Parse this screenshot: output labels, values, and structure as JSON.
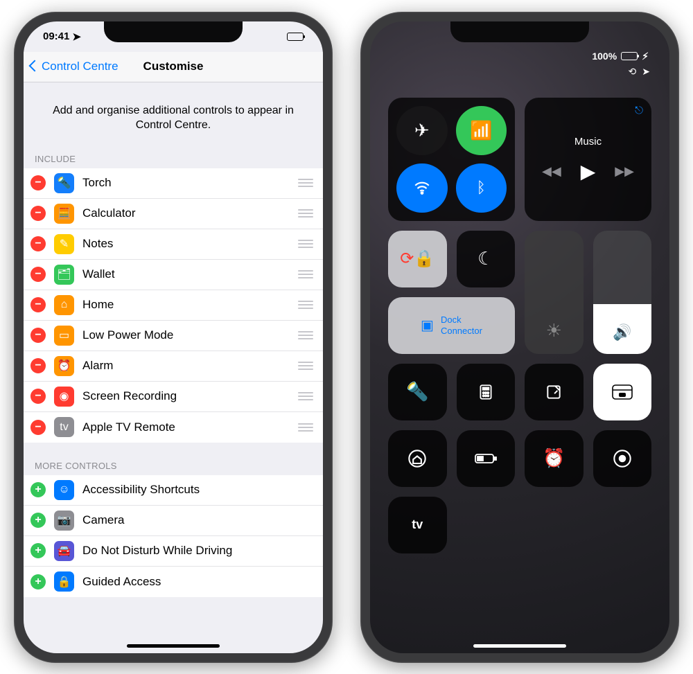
{
  "left": {
    "status_time": "09:41",
    "nav_back": "Control Centre",
    "nav_title": "Customise",
    "description": "Add and organise additional controls to appear in Control Centre.",
    "section_include": "Include",
    "section_more": "More Controls",
    "include": [
      {
        "label": "Torch",
        "color": "#147efb",
        "glyph": "🔦"
      },
      {
        "label": "Calculator",
        "color": "#ff9500",
        "glyph": "🧮"
      },
      {
        "label": "Notes",
        "color": "#ffcc00",
        "glyph": "✎"
      },
      {
        "label": "Wallet",
        "color": "#34c759",
        "glyph": "🗂"
      },
      {
        "label": "Home",
        "color": "#ff9500",
        "glyph": "⌂"
      },
      {
        "label": "Low Power Mode",
        "color": "#ff9500",
        "glyph": "▭"
      },
      {
        "label": "Alarm",
        "color": "#ff9500",
        "glyph": "⏰"
      },
      {
        "label": "Screen Recording",
        "color": "#ff3b30",
        "glyph": "◉"
      },
      {
        "label": "Apple TV Remote",
        "color": "#8e8e93",
        "glyph": "tv"
      }
    ],
    "more": [
      {
        "label": "Accessibility Shortcuts",
        "color": "#007aff",
        "glyph": "☺︎"
      },
      {
        "label": "Camera",
        "color": "#8e8e93",
        "glyph": "📷"
      },
      {
        "label": "Do Not Disturb While Driving",
        "color": "#5856d6",
        "glyph": "🚘"
      },
      {
        "label": "Guided Access",
        "color": "#007aff",
        "glyph": "🔒"
      }
    ]
  },
  "right": {
    "battery_pct": "100%",
    "music_label": "Music",
    "airplay_line1": "Dock",
    "airplay_line2": "Connector",
    "toggles": {
      "airplane": false,
      "cellular": true,
      "wifi": true,
      "bluetooth": true,
      "orientation_lock": true,
      "dnd": false
    },
    "sliders": {
      "brightness_pct": 0,
      "volume_pct": 40
    },
    "tiles": [
      "torch",
      "calculator",
      "notes",
      "wallet",
      "home",
      "low-power",
      "alarm",
      "screen-record",
      "apple-tv"
    ]
  }
}
